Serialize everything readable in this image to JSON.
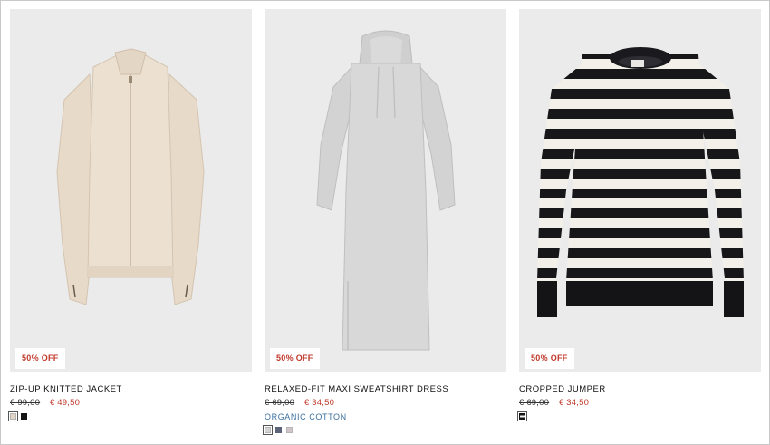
{
  "products": [
    {
      "badge": "50% OFF",
      "name": "ZIP-UP KNITTED JACKET",
      "old_price": "€ 99,00",
      "new_price": "€ 49,50",
      "tag": "",
      "image_icon": "knitted-jacket-image",
      "swatches": [
        "#e3d5c5",
        "#141414"
      ]
    },
    {
      "badge": "50% OFF",
      "name": "RELAXED-FIT MAXI SWEATSHIRT DRESS",
      "old_price": "€ 69,00",
      "new_price": "€ 34,50",
      "tag": "ORGANIC COTTON",
      "image_icon": "sweatshirt-dress-image",
      "swatches": [
        "#d3d3d5",
        "#5b6478",
        "#cfc4ca"
      ]
    },
    {
      "badge": "50% OFF",
      "name": "CROPPED JUMPER",
      "old_price": "€ 69,00",
      "new_price": "€ 34,50",
      "tag": "",
      "image_icon": "striped-jumper-image",
      "swatches": [
        "striped"
      ]
    }
  ]
}
